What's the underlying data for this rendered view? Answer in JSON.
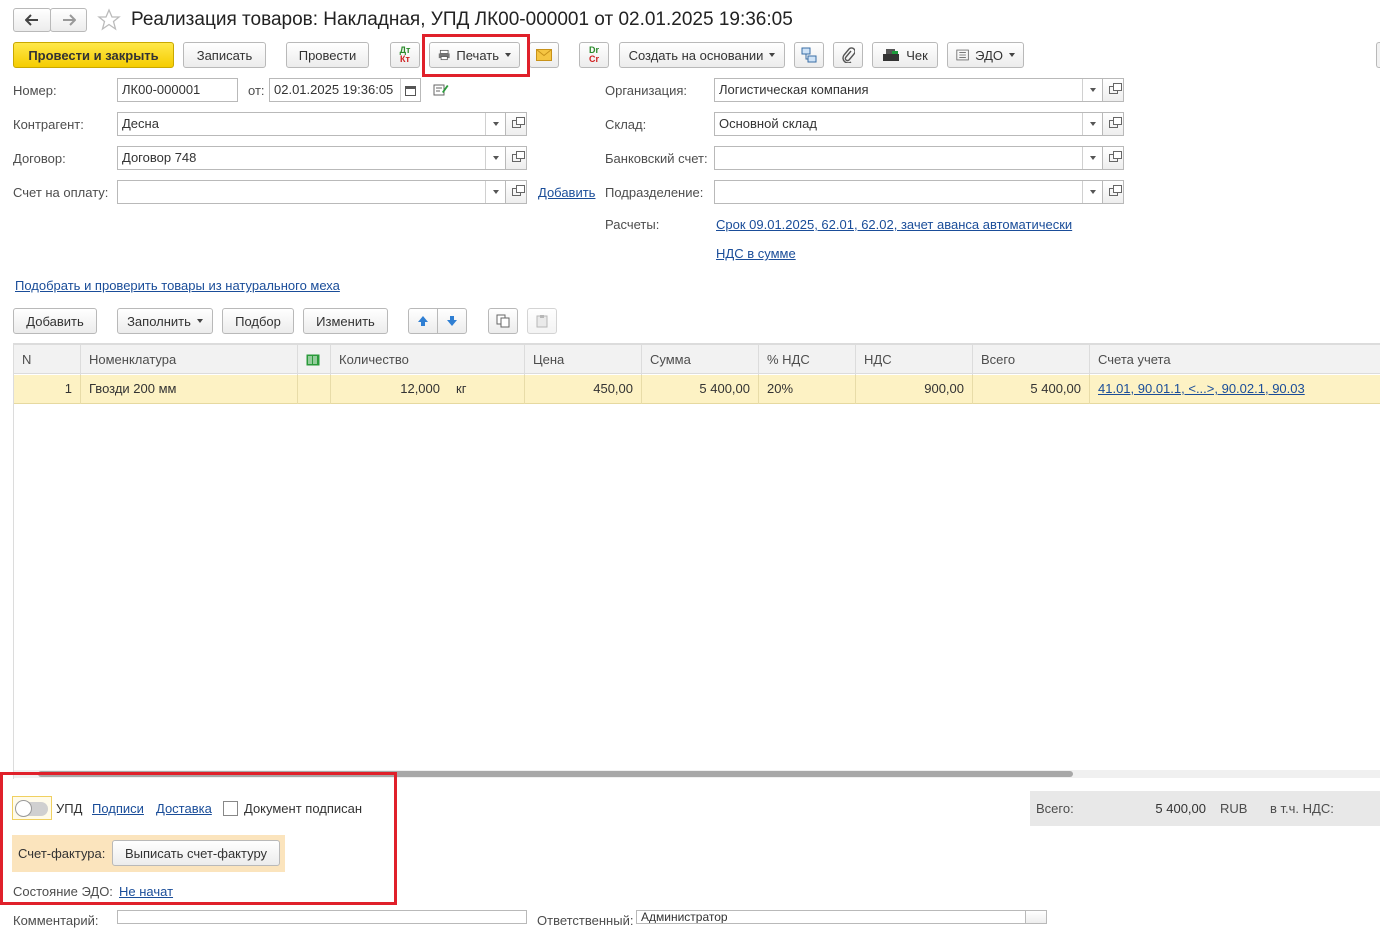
{
  "window": {
    "title": "Реализация товаров: Накладная, УПД ЛК00-000001 от 02.01.2025 19:36:05"
  },
  "toolbar": {
    "post_close": "Провести и закрыть",
    "save": "Записать",
    "post": "Провести",
    "dtkt_top": "Дт",
    "dtkt_bottom": "Кт",
    "print": "Печать",
    "drcr_top": "Dr",
    "drcr_bottom": "Cr",
    "create_based": "Создать на основании",
    "receipt": "Чек",
    "edo": "ЭДО"
  },
  "header": {
    "number_label": "Номер:",
    "number_value": "ЛК00-000001",
    "from_label": "от:",
    "date_value": "02.01.2025 19:36:05",
    "counterparty_label": "Контрагент:",
    "counterparty_value": "Десна",
    "contract_label": "Договор:",
    "contract_value": "Договор 748",
    "invoice_label": "Счет на оплату:",
    "invoice_value": "",
    "add_link": "Добавить",
    "org_label": "Организация:",
    "org_value": "Логистическая компания",
    "warehouse_label": "Склад:",
    "warehouse_value": "Основной склад",
    "bank_label": "Банковский счет:",
    "bank_value": "",
    "division_label": "Подразделение:",
    "division_value": "",
    "settlements_label": "Расчеты:",
    "settlements_link": "Срок 09.01.2025, 62.01, 62.02, зачет аванса автоматически",
    "vat_link": "НДС в сумме",
    "fur_link": "Подобрать и проверить товары из натурального меха"
  },
  "table_toolbar": {
    "add": "Добавить",
    "fill": "Заполнить",
    "pick": "Подбор",
    "change": "Изменить"
  },
  "table": {
    "columns": [
      "N",
      "Номенклатура",
      "Количество",
      "Цена",
      "Сумма",
      "% НДС",
      "НДС",
      "Всего",
      "Счета учета"
    ],
    "rows": [
      {
        "n": "1",
        "item": "Гвозди 200 мм",
        "qty": "12,000",
        "unit": "кг",
        "price": "450,00",
        "sum": "5 400,00",
        "vat_rate": "20%",
        "vat": "900,00",
        "total": "5 400,00",
        "accounts": "41.01, 90.01.1, <...>, 90.02.1, 90.03"
      }
    ]
  },
  "footer": {
    "upd_label": "УПД",
    "signatures_link": "Подписи",
    "delivery_link": "Доставка",
    "signed_label": "Документ подписан",
    "invoice_label": "Счет-фактура:",
    "invoice_button": "Выписать счет-фактуру",
    "edo_state_label": "Состояние ЭДО:",
    "edo_state_link": "Не начат",
    "total_label": "Всего:",
    "total_value": "5 400,00",
    "currency": "RUB",
    "vat_incl_label": "в т.ч. НДС:",
    "comment_label": "Комментарий:",
    "responsible_label": "Ответственный:",
    "responsible_value": "Администратор"
  },
  "colors": {
    "highlight_box": "#e0202a",
    "primary_button": "#f5cc00",
    "selected_row": "#fdf2c4",
    "link": "#1a4d99"
  }
}
